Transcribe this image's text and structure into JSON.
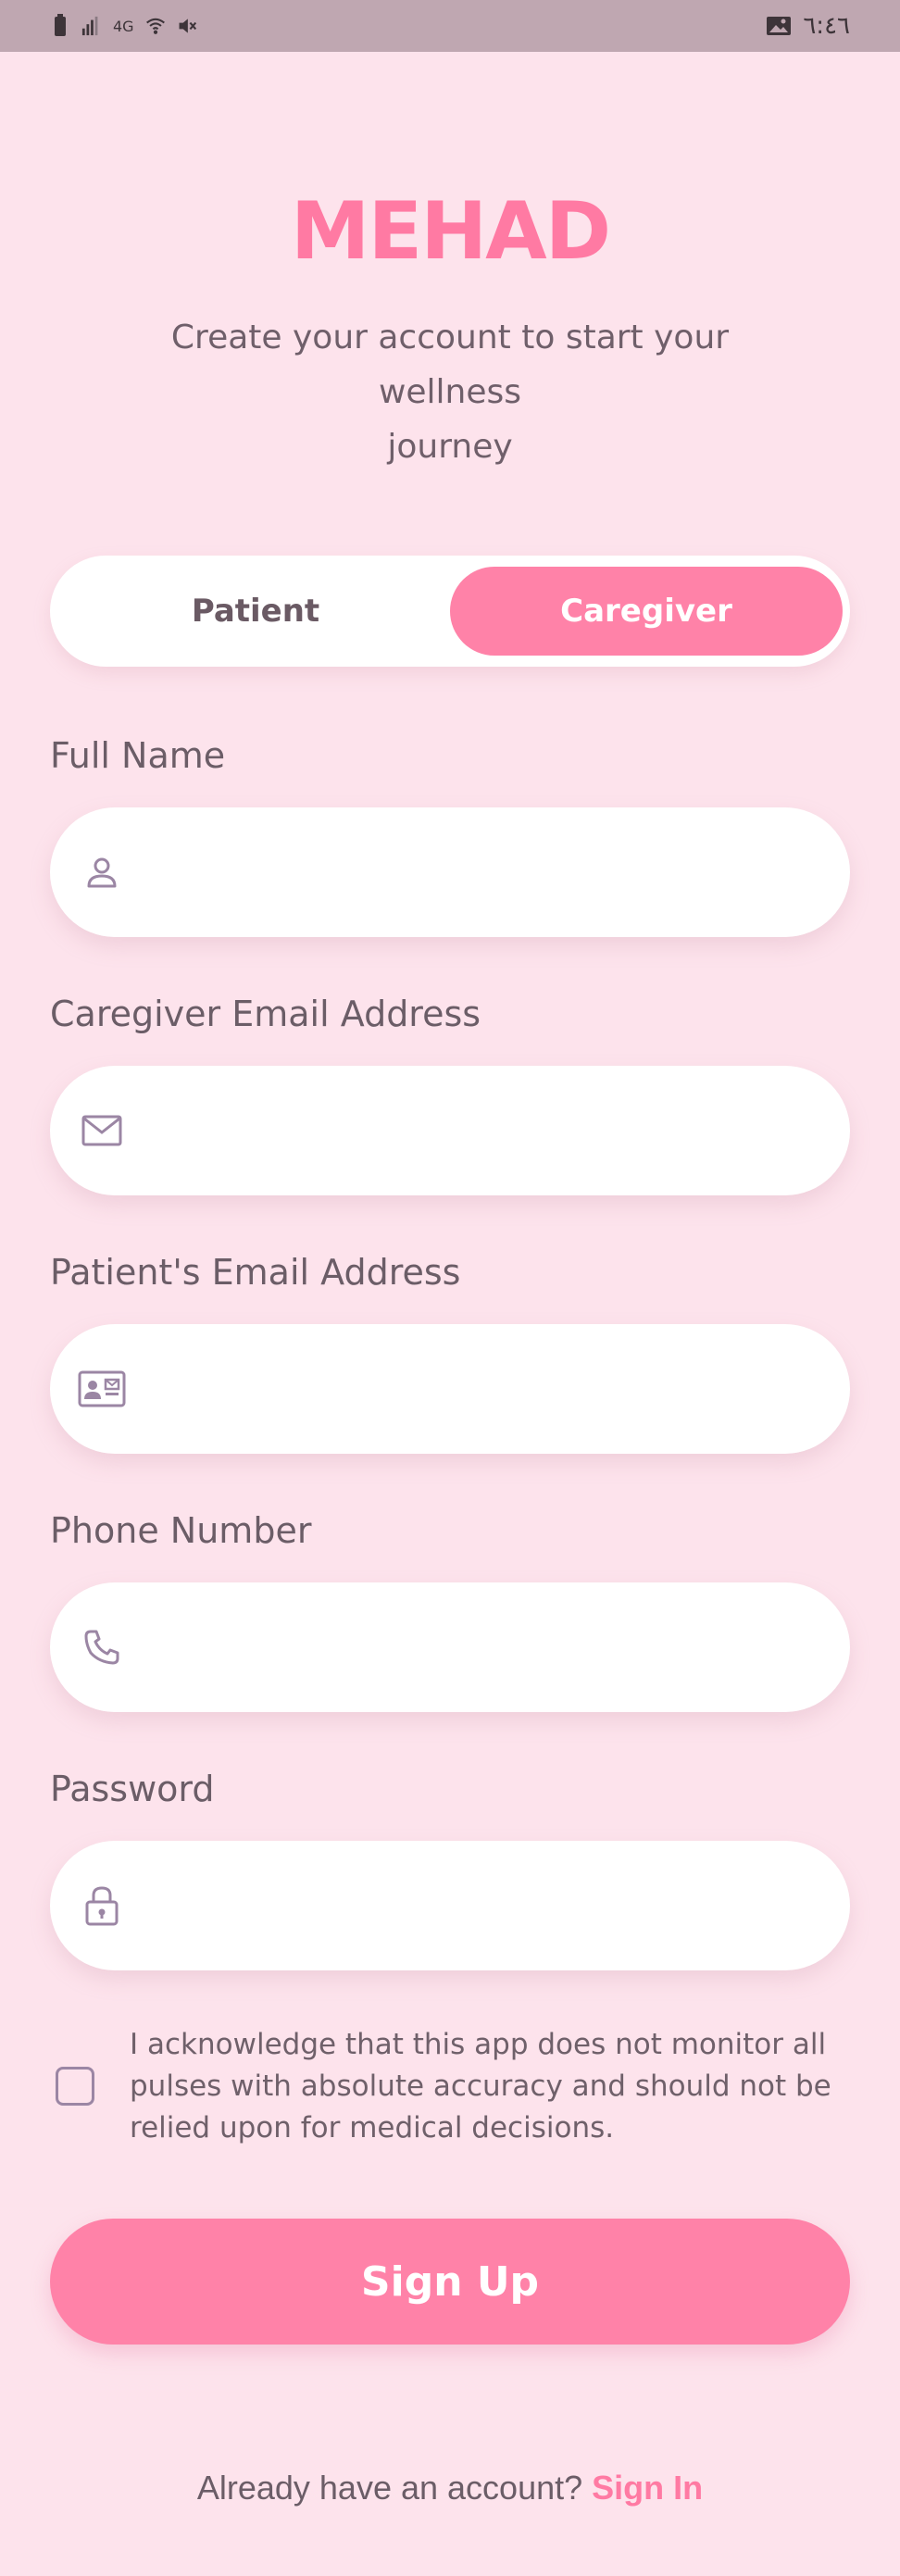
{
  "statusbar": {
    "time": "٦:٤٦",
    "signal_label": "4G"
  },
  "app": {
    "brand": "MEHAD",
    "subtitle_line1": "Create your account to start your",
    "subtitle_line2": "wellness",
    "subtitle_line3": "journey"
  },
  "role_toggle": {
    "options": [
      "Patient",
      "Caregiver"
    ],
    "selected": "Caregiver"
  },
  "fields": {
    "full_name": {
      "label": "Full Name",
      "value": "",
      "icon": "person-icon"
    },
    "caregiver_email": {
      "label": "Caregiver Email Address",
      "value": "",
      "icon": "mail-icon"
    },
    "patient_email": {
      "label": "Patient's Email Address",
      "value": "",
      "icon": "contact-card-icon"
    },
    "phone": {
      "label": "Phone Number",
      "value": "",
      "icon": "phone-icon"
    },
    "password": {
      "label": "Password",
      "value": "",
      "icon": "lock-icon"
    }
  },
  "acknowledgement": {
    "checked": false,
    "text": "I acknowledge that this app does not monitor all pulses with absolute accuracy and should not be relied upon for medical decisions."
  },
  "actions": {
    "signup_label": "Sign Up",
    "signin_prompt": "Already have an account?",
    "signin_link": "Sign In"
  },
  "colors": {
    "background": "#fde3ec",
    "accent": "#ff82a8",
    "brand": "#ff7aa3",
    "icon": "#9b86a4"
  }
}
